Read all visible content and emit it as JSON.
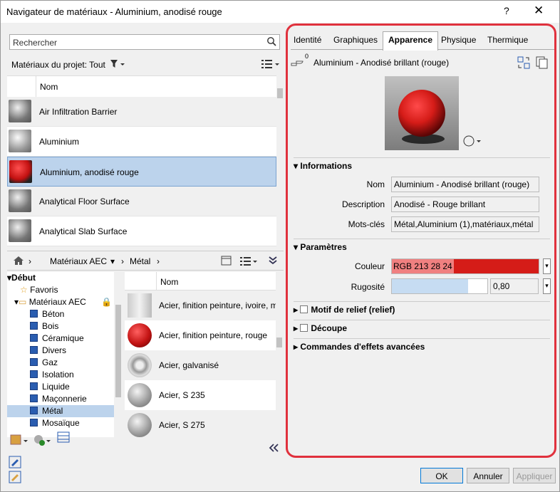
{
  "window": {
    "title": "Navigateur de matériaux - Aluminium, anodisé rouge",
    "help_label": "?",
    "close_label": "✕"
  },
  "search": {
    "placeholder": "Rechercher"
  },
  "filter": {
    "label": "Matériaux du projet: Tout"
  },
  "project_list": {
    "column_header": "Nom",
    "items": [
      "Air Infiltration Barrier",
      "Aluminium",
      "Aluminium, anodisé rouge",
      "Analytical Floor Surface",
      "Analytical Slab Surface"
    ],
    "selected": "Aluminium, anodisé rouge"
  },
  "breadcrumb": {
    "items": [
      "Matériaux AEC",
      "Métal"
    ]
  },
  "tree": {
    "root": "Début",
    "favorites": "Favoris",
    "library": "Matériaux AEC",
    "categories": [
      "Béton",
      "Bois",
      "Céramique",
      "Divers",
      "Gaz",
      "Isolation",
      "Liquide",
      "Maçonnerie",
      "Métal",
      "Mosaïque"
    ],
    "selected": "Métal"
  },
  "library_list": {
    "column_header": "Nom",
    "items": [
      "Acier, finition peinture, ivoire, m",
      "Acier, finition peinture, rouge",
      "Acier, galvanisé",
      "Acier, S 235",
      "Acier, S 275"
    ]
  },
  "tabs": {
    "items": [
      "Identité",
      "Graphiques",
      "Apparence",
      "Physique",
      "Thermique"
    ],
    "active": "Apparence"
  },
  "asset": {
    "count": "0",
    "name": "Aluminium - Anodisé brillant (rouge)"
  },
  "informations": {
    "title": "Informations",
    "name_label": "Nom",
    "name_value": "Aluminium - Anodisé brillant (rouge)",
    "desc_label": "Description",
    "desc_value": "Anodisé - Rouge brillant",
    "keywords_label": "Mots-clés",
    "keywords_value": "Métal,Aluminium (1),matériaux,métal"
  },
  "parametres": {
    "title": "Paramètres",
    "color_label": "Couleur",
    "color_value": "RGB 213 28 24",
    "color_hex": "#d51c18",
    "roughness_label": "Rugosité",
    "roughness_value": "0,80",
    "roughness_fraction": 0.8
  },
  "sections": {
    "relief": "Motif de relief (relief)",
    "decoupe": "Découpe",
    "advanced": "Commandes d'effets avancées"
  },
  "buttons": {
    "ok": "OK",
    "cancel": "Annuler",
    "apply": "Appliquer"
  },
  "highlight_color": "#e0313d"
}
